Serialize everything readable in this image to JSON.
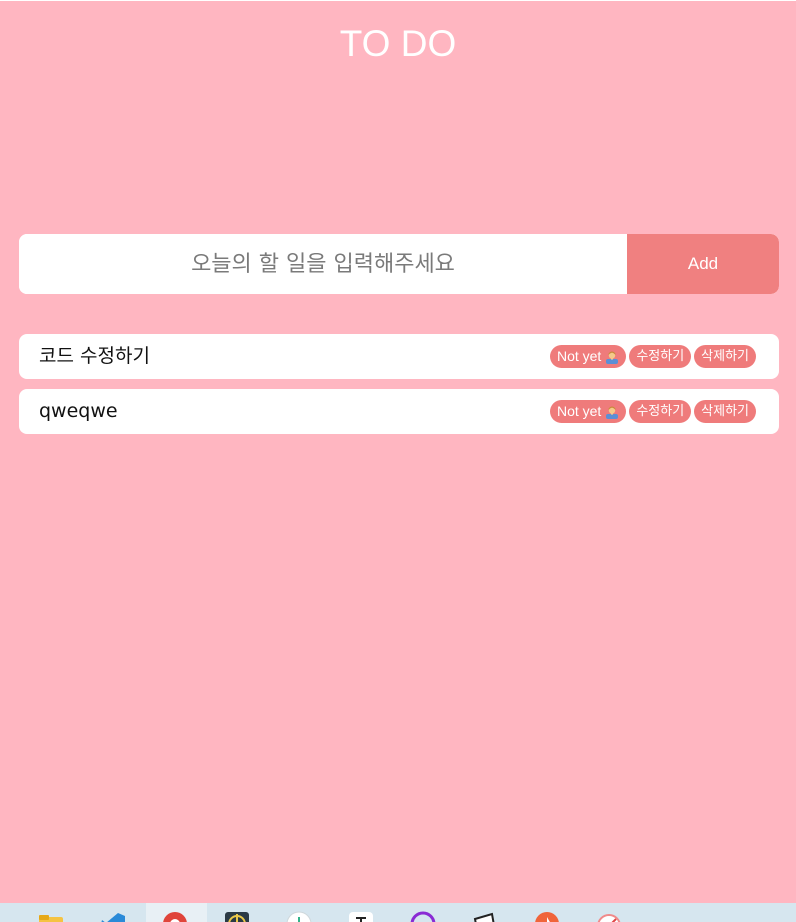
{
  "app": {
    "title": "TO DO"
  },
  "input": {
    "placeholder": "오늘의 할 일을 입력해주세요",
    "value": "",
    "add_label": "Add"
  },
  "todos": [
    {
      "text": "코드 수정하기",
      "status_label": "Not yet",
      "status_icon": "person-icon",
      "edit_label": "수정하기",
      "delete_label": "삭제하기"
    },
    {
      "text": "qweqwe",
      "status_label": "Not yet",
      "status_icon": "person-icon",
      "edit_label": "수정하기",
      "delete_label": "삭제하기"
    }
  ],
  "taskbar": {
    "icons": [
      "file-explorer-icon",
      "vscode-icon",
      "chrome-icon",
      "app-icon",
      "app-icon",
      "app-icon",
      "app-icon",
      "app-icon",
      "app-icon",
      "app-icon"
    ]
  },
  "colors": {
    "background": "#ffb6c1",
    "accent": "#f08080",
    "pill": "#ef7b7b",
    "text": "#ffffff"
  }
}
